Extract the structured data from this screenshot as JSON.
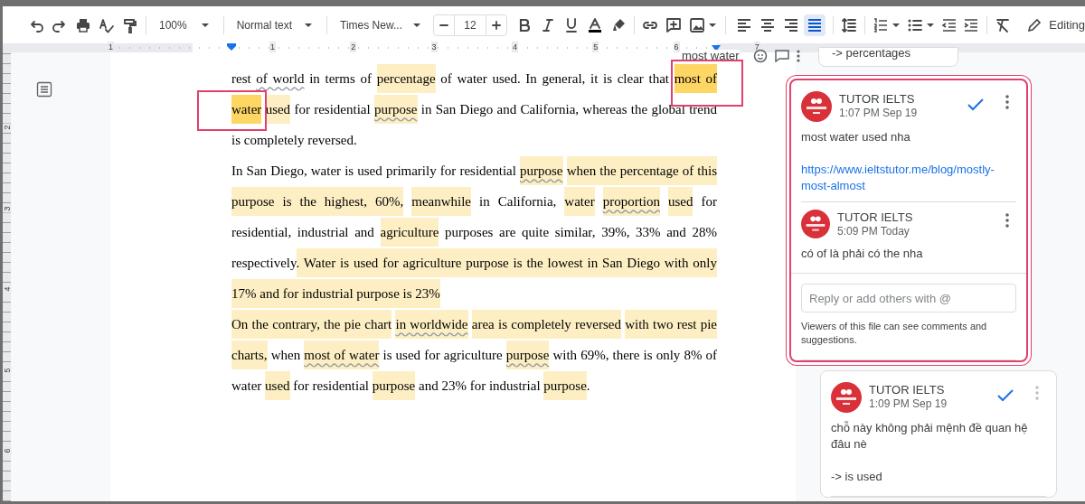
{
  "toolbar": {
    "zoom": "100%",
    "style": "Normal text",
    "font": "Times New...",
    "font_size": "12",
    "alignments": [
      {
        "kind": "left",
        "selected": false
      },
      {
        "kind": "center",
        "selected": false
      },
      {
        "kind": "right",
        "selected": false
      },
      {
        "kind": "justify",
        "selected": true
      }
    ],
    "mode": "Editing"
  },
  "ruler": {
    "labels": [
      "1",
      "1",
      "2",
      "3",
      "4",
      "5",
      "6",
      "7"
    ]
  },
  "vertical_ruler": {
    "labels": [
      "2",
      "3",
      "4",
      "5",
      "6"
    ]
  },
  "floating_snippet": "most water",
  "document": {
    "paragraphs": [
      [
        [
          {
            "text": "rest "
          },
          {
            "text": "of world",
            "underline": true
          },
          {
            "text": " in terms of "
          },
          {
            "text": "percentage",
            "highlighted": true
          },
          {
            "text": " of water used. In general, it is clear that "
          },
          {
            "text": "most of",
            "highlighted": true,
            "selected": true
          }
        ],
        [
          {
            "text": "water",
            "highlighted": true,
            "selected": true
          },
          {
            "text": " used",
            "highlighted": true
          },
          {
            "text": " for residential "
          },
          {
            "text": "purpose",
            "highlighted": true,
            "underline": true
          },
          {
            "text": " in San Diego and California, whereas the global trend"
          }
        ],
        [
          {
            "text": "is completely reversed."
          }
        ]
      ],
      [
        [
          {
            "text": "In San Diego, water is used primarily for residential "
          },
          {
            "text": "purpose",
            "highlighted": true,
            "underline": true
          },
          {
            "text": " when the percentage of this",
            "highlighted": true
          }
        ],
        [
          {
            "text": "purpose is the highest, 60%,",
            "highlighted": true
          },
          {
            "text": " meanwhile",
            "highlighted": true
          },
          {
            "text": " in California, "
          },
          {
            "text": "water ",
            "highlighted": true
          },
          {
            "text": "proportion",
            "highlighted": true,
            "underline": true
          },
          {
            "text": " used",
            "highlighted": true
          },
          {
            "text": " for"
          }
        ],
        [
          {
            "text": "residential, industrial and "
          },
          {
            "text": "agriculture",
            "highlighted": true
          },
          {
            "text": " purposes are quite similar, 39%, 33% and 28%"
          }
        ],
        [
          {
            "text": "respectively"
          },
          {
            "text": ". Water is used for agriculture purpose is the lowest in San Diego with only",
            "highlighted": true
          }
        ],
        [
          {
            "text": "17% and for industrial purpose is 23%",
            "highlighted": true
          }
        ]
      ],
      [
        [
          {
            "text": "On the contrary, the pie chart ",
            "highlighted": true
          },
          {
            "text": "in worldwide",
            "highlighted": true,
            "underline": true
          },
          {
            "text": " area is completely reversed",
            "highlighted": true
          },
          {
            "text": " with two rest pie",
            "highlighted": true
          }
        ],
        [
          {
            "text": "charts,",
            "highlighted": true
          },
          {
            "text": " when "
          },
          {
            "text": "most of water",
            "highlighted": true,
            "underline": true
          },
          {
            "text": " is used for agriculture "
          },
          {
            "text": "purpose",
            "highlighted": true,
            "underline": true
          },
          {
            "text": " with 69%, there is only 8% of"
          }
        ],
        [
          {
            "text": "water "
          },
          {
            "text": "used",
            "highlighted": true
          },
          {
            "text": " for residential "
          },
          {
            "text": "purpose",
            "highlighted": true
          },
          {
            "text": " and 23% for industrial "
          },
          {
            "text": "purpose",
            "highlighted": true
          },
          {
            "text": "."
          }
        ]
      ]
    ]
  },
  "comments": [
    {
      "kind": "partial",
      "text": "-> percentages"
    },
    {
      "kind": "thread",
      "selected": true,
      "entries": [
        {
          "author": "TUTOR IELTS",
          "time": "1:07 PM Sep 19",
          "resolvable": true,
          "body": [
            {
              "kind": "text",
              "text": "most water used nha"
            },
            {
              "kind": "link",
              "text": "https://www.ieltstutor.me/blog/mostly-most-almost"
            }
          ]
        },
        {
          "author": "TUTOR IELTS",
          "time": "5:09 PM Today",
          "resolvable": false,
          "body": [
            {
              "kind": "text",
              "text": "có of là phải có the nha"
            }
          ]
        }
      ],
      "reply_placeholder": "Reply or add others with @",
      "note": "Viewers of this file can see comments and suggestions."
    },
    {
      "kind": "thread",
      "selected": false,
      "entries": [
        {
          "author": "TUTOR IELTS",
          "time": "1:09 PM Sep 19",
          "resolvable": true,
          "body": [
            {
              "kind": "text",
              "text": "chỗ này không phải mệnh đề quan hệ đâu nè"
            },
            {
              "kind": "text",
              "text": "-> is used"
            }
          ]
        }
      ]
    }
  ]
}
